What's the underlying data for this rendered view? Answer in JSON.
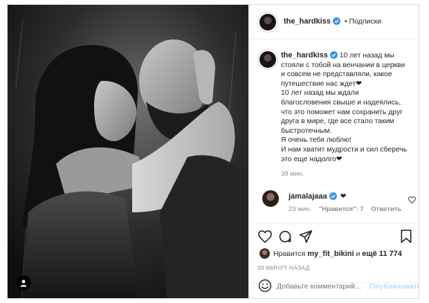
{
  "post": {
    "username": "the_hardkiss",
    "follow_status": "• Подписки",
    "caption_lines": [
      "10 лет назад мы",
      "стояли с тобой на венчании в церкви",
      "и совсем не представляли, какое",
      "путешествие нас ждет❤",
      "10 лет назад мы ждали",
      "благословения свыше и надеялись,",
      "что это поможет нам сохранить друг",
      "друга в мире, где все стало таким",
      "быстротечным.",
      "Я очень тебя люблю!",
      "И нам хватит мудрости и сил сберечь",
      "это еще надолго❤"
    ],
    "caption_time": "39 мин."
  },
  "comment": {
    "username": "jamalajaaa",
    "text": "❤",
    "time": "23 мин.",
    "likes": "\"Нравится\": 7",
    "reply": "Ответить"
  },
  "likes": {
    "prefix": "Нравится",
    "user": "my_fit_bikini",
    "connector": "и",
    "rest": "ещё 11 774"
  },
  "timestamp": "39 МИНУТ НАЗАД",
  "comment_input": {
    "placeholder": "Добавьте комментарий...",
    "publish": "Опубликовать"
  },
  "colors": {
    "verified": "#3897f0",
    "publish": "#b2dffc",
    "muted": "#8e8e8e"
  },
  "icons": [
    "verified-icon",
    "heart-icon",
    "comment-icon",
    "share-icon",
    "bookmark-icon",
    "smile-icon",
    "tag-user-icon"
  ]
}
